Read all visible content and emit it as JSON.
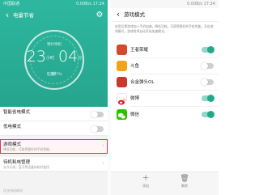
{
  "left": {
    "status": {
      "carrier": "中国联通",
      "speed": "0.00B/s",
      "clock": "17:24"
    },
    "title": "电量节省",
    "dial": {
      "caption": "预计待机",
      "hours": "23",
      "hours_unit": "小时",
      "minutes": "04",
      "minutes_unit": "分钟",
      "battery": "电量77%"
    },
    "rows": [
      {
        "title": "智能省电模式",
        "sub": "",
        "control": "toggle-off"
      },
      {
        "title": "低电模式",
        "sub": "",
        "control": "toggle-off"
      },
      {
        "title": "游戏模式",
        "sub": "降低功耗，可取得更好的手机性能。",
        "control": "chevron",
        "highlight": true
      },
      {
        "title": "待机耗电管理",
        "sub": "允许无线，蓝牙等设备待机时使用",
        "control": "chevron"
      }
    ],
    "footer": "优化待机耗电"
  },
  "right": {
    "status": {
      "speed": "0.00B/s",
      "clock": "17:24"
    },
    "title": "游戏模式",
    "intro": "启用后把游戏加入手机加速，降低功耗，可获得更好的手机性能。开启游戏模式，游戏时将自动开启加速模式。",
    "apps": [
      {
        "name": "王者荣耀",
        "icon": "wangzhe-icon",
        "color": "#d24a2c",
        "on": true
      },
      {
        "name": "斗鱼",
        "icon": "douyu-icon",
        "color": "#f4a21b",
        "on": false
      },
      {
        "name": "合金弹头OL",
        "icon": "metal-slug-icon",
        "color": "#c7392b",
        "on": false
      },
      {
        "name": "微博",
        "icon": "weibo-icon",
        "color": "#ffffff",
        "on": true
      },
      {
        "name": "微信",
        "icon": "wechat-icon",
        "color": "#2dc100",
        "on": true
      }
    ],
    "bottom": {
      "add_icon": "plus-icon",
      "add_label": "添加",
      "delete_icon": "trash-icon",
      "delete_label": "删除"
    }
  },
  "colors": {
    "accent": "#26a58d",
    "highlight": "#e0364a",
    "toggle_on": "#23a88a"
  }
}
